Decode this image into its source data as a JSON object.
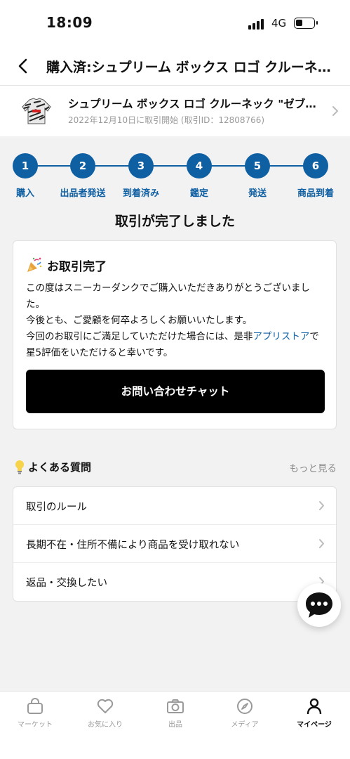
{
  "status_bar": {
    "time": "18:09",
    "network": "4G"
  },
  "header": {
    "title": "購入済:シュプリーム ボックス ロゴ クルーネック \"ゼブラ\""
  },
  "product": {
    "name": "シュプリーム ボックス ロゴ クルーネック \"ゼブラ\"",
    "subtitle": "2022年12月10日に取引開始 (取引ID：12808766)"
  },
  "steps": [
    {
      "number": "1",
      "label": "購入"
    },
    {
      "number": "2",
      "label": "出品者発送"
    },
    {
      "number": "3",
      "label": "到着済み"
    },
    {
      "number": "4",
      "label": "鑑定"
    },
    {
      "number": "5",
      "label": "発送"
    },
    {
      "number": "6",
      "label": "商品到着"
    }
  ],
  "status_heading": "取引が完了しました",
  "card": {
    "title": "お取引完了",
    "line1": "この度はスニーカーダンクでご購入いただきありがとうございました。",
    "line2": "今後とも、ご愛顧を何卒よろしくお願いいたします。",
    "line3_before": "今回のお取引にご満足していただけた場合には、是非",
    "line3_link": "アプリストア",
    "line3_after": "で星5評価をいただけると幸いです。",
    "button": "お問い合わせチャット"
  },
  "faq": {
    "title": "よくある質問",
    "more": "もっと見る",
    "items": [
      "取引のルール",
      "長期不在・住所不備により商品を受け取れない",
      "返品・交換したい"
    ]
  },
  "tabs": [
    {
      "label": "マーケット",
      "icon": "bag-icon"
    },
    {
      "label": "お気に入り",
      "icon": "heart-icon"
    },
    {
      "label": "出品",
      "icon": "camera-icon"
    },
    {
      "label": "メディア",
      "icon": "compass-icon"
    },
    {
      "label": "マイページ",
      "icon": "person-icon",
      "active": true
    }
  ],
  "colors": {
    "accent": "#0f5fa3",
    "button": "#000000",
    "background": "#f2f2f2"
  }
}
